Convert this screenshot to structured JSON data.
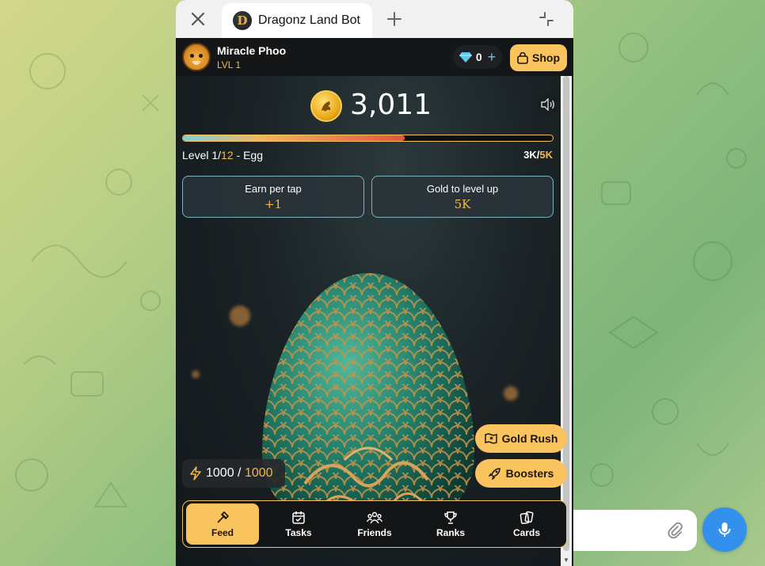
{
  "window": {
    "tab_title": "Dragonz Land Bot",
    "tab_logo_letter": "D"
  },
  "header": {
    "user_name": "Miracle Phoo",
    "user_level": "LVL 1",
    "gems": "0",
    "shop_label": "Shop"
  },
  "balance": {
    "coins": "3,011"
  },
  "progress": {
    "fraction": 0.6,
    "level_prefix": "Level 1/",
    "level_max": "12",
    "level_suffix": " - Egg",
    "xp_current": "3K/",
    "xp_target": "5K"
  },
  "stats": {
    "earn_label": "Earn per tap",
    "earn_value": "+1",
    "gold_label": "Gold to level up",
    "gold_value": "5K"
  },
  "energy": {
    "current": "1000 / ",
    "max": "1000"
  },
  "actions": {
    "gold_rush": "Gold Rush",
    "boosters": "Boosters"
  },
  "nav": {
    "feed": "Feed",
    "tasks": "Tasks",
    "friends": "Friends",
    "ranks": "Ranks",
    "cards": "Cards"
  },
  "colors": {
    "accent": "#f9c35d",
    "gold_text": "#f3b84a",
    "mic": "#3390ec"
  }
}
